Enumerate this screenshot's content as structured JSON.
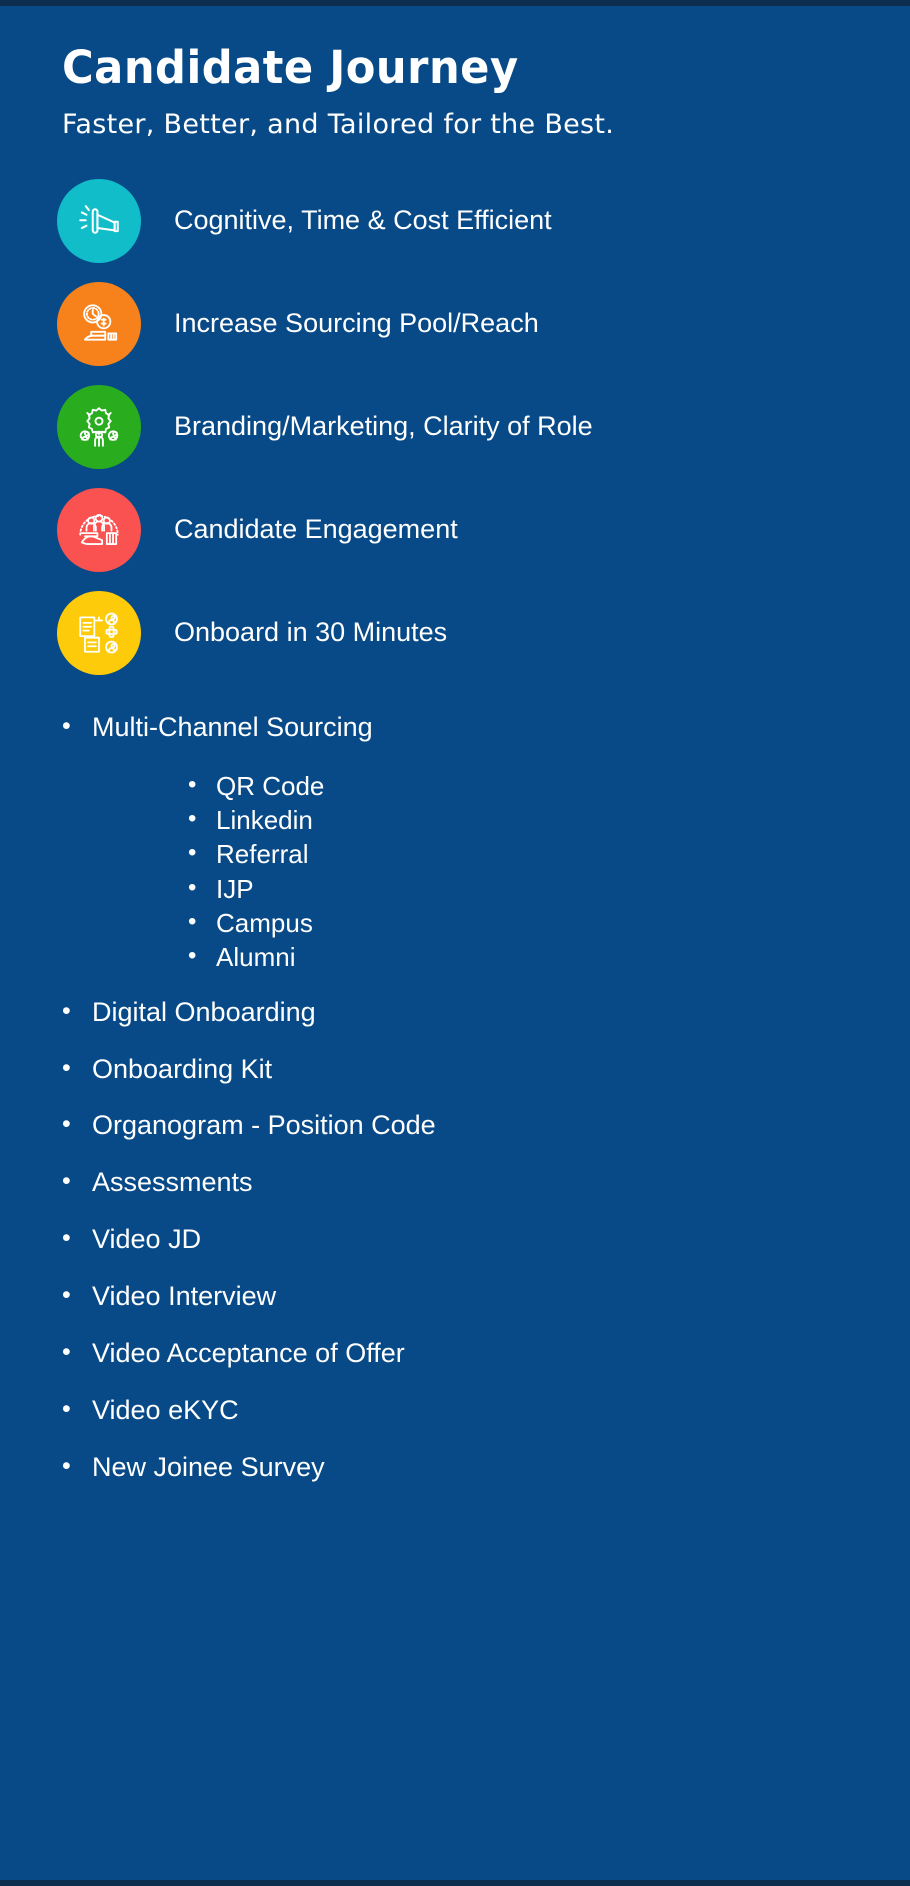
{
  "header": {
    "title": "Candidate Journey",
    "subtitle": "Faster, Better, and Tailored for the Best."
  },
  "colors": {
    "background": "#084a87",
    "text": "#ffffff",
    "badge_teal": "#10bdc9",
    "badge_orange": "#f7821b",
    "badge_green": "#2aac1f",
    "badge_red": "#fa5250",
    "badge_yellow": "#fdcb0a"
  },
  "badges": [
    {
      "icon": "megaphone-icon",
      "color": "#10bdc9",
      "label": "Cognitive, Time & Cost Efficient"
    },
    {
      "icon": "clock-coins-icon",
      "color": "#f7821b",
      "label": "Increase Sourcing Pool/Reach"
    },
    {
      "icon": "gear-people-icon",
      "color": "#2aac1f",
      "label": "Branding/Marketing, Clarity of Role"
    },
    {
      "icon": "hand-people-icon",
      "color": "#fa5250",
      "label": "Candidate Engagement"
    },
    {
      "icon": "documents-people-gear-icon",
      "color": "#fdcb0a",
      "label": "Onboard in 30 Minutes"
    }
  ],
  "bullet_marker": "•",
  "bullets": {
    "first": {
      "label": "Multi-Channel Sourcing",
      "children": [
        "QR Code",
        "Linkedin",
        "Referral",
        "IJP",
        "Campus",
        "Alumni"
      ]
    },
    "rest": [
      "Digital Onboarding",
      "Onboarding Kit",
      "Organogram - Position Code",
      "Assessments",
      "Video JD",
      "Video Interview",
      "Video Acceptance of Offer",
      "Video eKYC",
      "New Joinee Survey"
    ]
  }
}
